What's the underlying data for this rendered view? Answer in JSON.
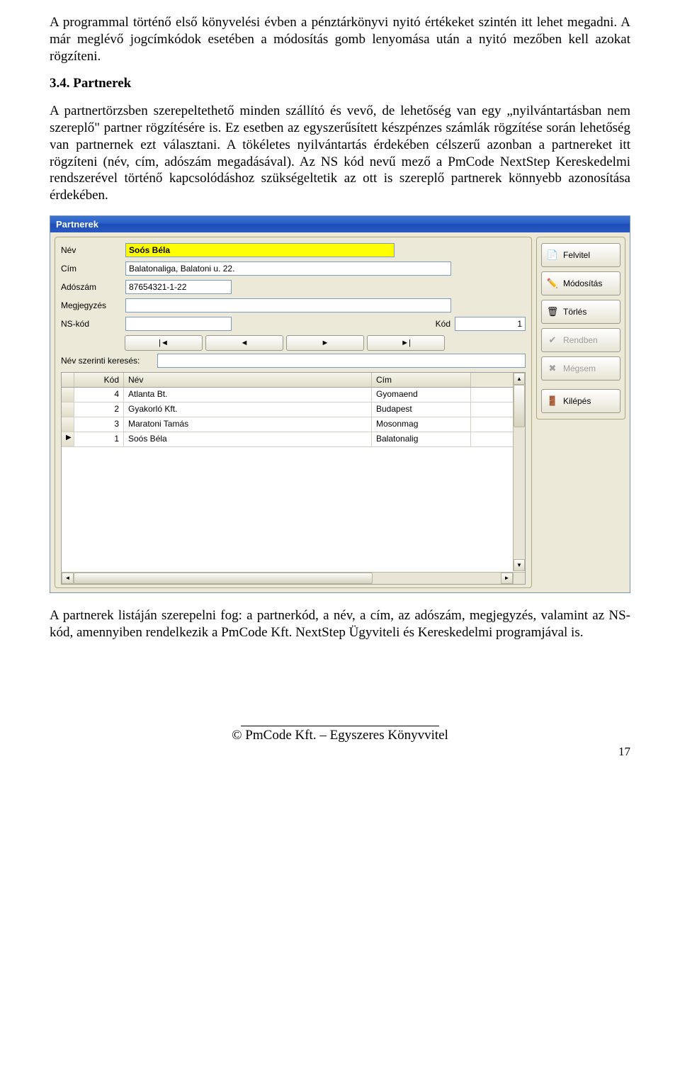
{
  "paragraphs": {
    "p1": "A programmal történő első könyvelési évben a pénztárkönyvi nyitó értékeket szintén itt lehet megadni. A már meglévő jogcímkódok esetében a módosítás gomb lenyomása után a nyitó mezőben kell azokat rögzíteni.",
    "heading": "3.4. Partnerek",
    "p2": "A partnertörzsben szerepeltethető minden szállító és vevő, de lehetőség van egy „nyilvántartásban nem szereplő\" partner rögzítésére is. Ez esetben az egyszerűsített készpénzes számlák rögzítése során lehetőség van partnernek ezt választani. A tökéletes nyilvántartás érdekében célszerű azonban a partnereket itt rögzíteni (név, cím, adószám megadásával). Az NS kód nevű mező a PmCode NextStep Kereskedelmi rendszerével történő kapcsolódáshoz szükségeltetik az ott is szereplő partnerek könnyebb azonosítása érdekében.",
    "p3": "A partnerek listáján szerepelni fog: a partnerkód, a név, a cím, az adószám, megjegyzés, valamint az NS-kód, amennyiben rendelkezik a PmCode Kft. NextStep Ügyviteli és Kereskedelmi programjával is."
  },
  "window": {
    "title": "Partnerek",
    "labels": {
      "nev": "Név",
      "cim": "Cím",
      "adoszam": "Adószám",
      "megjegyzes": "Megjegyzés",
      "nskod": "NS-kód",
      "kod": "Kód",
      "search": "Név szerinti keresés:"
    },
    "values": {
      "nev": "Soós Béla",
      "cim": "Balatonaliga, Balatoni u. 22.",
      "adoszam": "87654321-1-22",
      "megjegyzes": "",
      "nskod": "",
      "kod": "1",
      "search": ""
    },
    "nav": {
      "first": "|◄",
      "prev": "◄",
      "next": "►",
      "last": "►|"
    },
    "grid": {
      "headers": {
        "kod": "Kód",
        "nev": "Név",
        "cim": "Cím"
      },
      "rows": [
        {
          "ind": "",
          "kod": "4",
          "nev": "Atlanta Bt.",
          "cim": "Gyomaend"
        },
        {
          "ind": "",
          "kod": "2",
          "nev": "Gyakorló Kft.",
          "cim": "Budapest"
        },
        {
          "ind": "",
          "kod": "3",
          "nev": "Maratoni Tamás",
          "cim": "Mosonmag"
        },
        {
          "ind": "▶",
          "kod": "1",
          "nev": "Soós Béla",
          "cim": "Balatonalig"
        }
      ]
    },
    "buttons": {
      "felvitel": "Felvitel",
      "modositas": "Módosítás",
      "torles": "Törlés",
      "rendben": "Rendben",
      "megsem": "Mégsem",
      "kilepes": "Kilépés"
    }
  },
  "footer": {
    "company": "© PmCode Kft. – Egyszeres Könyvvitel",
    "page": "17"
  }
}
